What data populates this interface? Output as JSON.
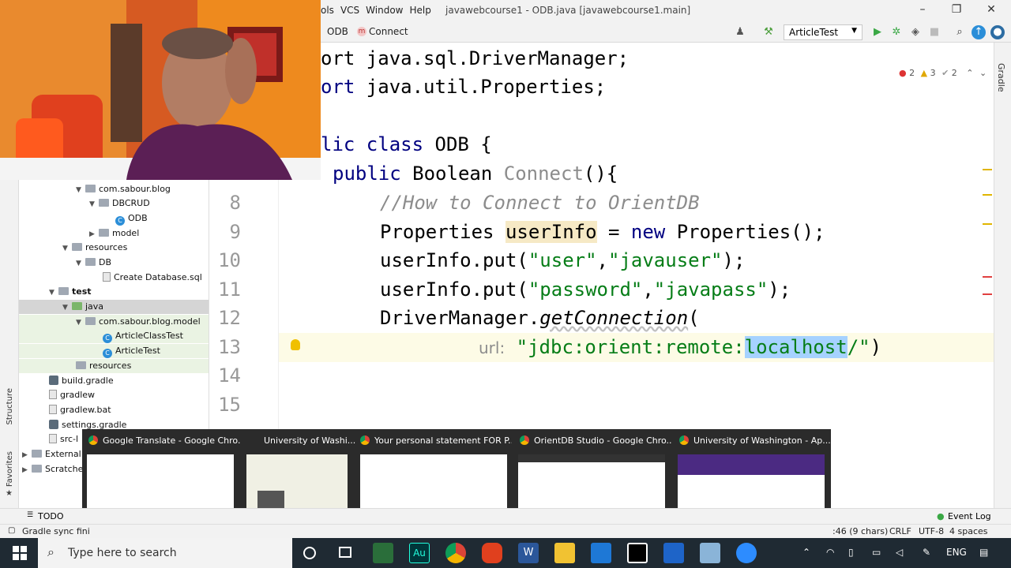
{
  "menu": [
    "ols",
    "VCS",
    "Window",
    "Help"
  ],
  "window_title": "javawebcourse1 - ODB.java [javawebcourse1.main]",
  "breadcrumb": {
    "file": "ODB",
    "method_badge": "m",
    "method": "Connect"
  },
  "run_config": "ArticleTest",
  "inspections": {
    "errors": "2",
    "warnings": "3",
    "weak": "2"
  },
  "side_tabs": {
    "gradle": "Gradle",
    "structure": "Structure",
    "favorites": "Favorites"
  },
  "tree": {
    "pkg_blog": "com.sabour.blog",
    "dbcrud": "DBCRUD",
    "odb": "ODB",
    "model": "model",
    "resources": "resources",
    "db": "DB",
    "create_db": "Create Database.sql",
    "test": "test",
    "java": "java",
    "pkg_model": "com.sabour.blog.model",
    "article_class_test": "ArticleClassTest",
    "article_test": "ArticleTest",
    "resources2": "resources",
    "build_gradle": "build.gradle",
    "gradlew": "gradlew",
    "gradlew_bat": "gradlew.bat",
    "settings_gradle": "settings.gradle",
    "src": "src-l",
    "external": "External",
    "scratches": "Scratche"
  },
  "code": {
    "l_top": "ort java.sql.DriverManager;",
    "l_props_pre": "ort ",
    "l_props": "java.util.Properties;",
    "l_class_pre": "lic ",
    "l_class_kw": "class",
    "l_class_name": " ODB {",
    "l_pub": "public",
    "l_bool": " Boolean ",
    "l_connect": "Connect",
    "l_paren": "(){",
    "n8": "8",
    "c8": "//How to Connect to OrientDB",
    "n9": "9",
    "c9a": "Properties ",
    "c9b": "userInfo",
    "c9c": " = ",
    "c9d": "new",
    "c9e": " Properties();",
    "n10": "10",
    "c10a": "userInfo.put(",
    "c10b": "\"user\"",
    "c10c": ",",
    "c10d": "\"javauser\"",
    "c10e": ");",
    "n11": "11",
    "c11a": "userInfo.put(",
    "c11b": "\"password\"",
    "c11c": ",",
    "c11d": "\"javapass\"",
    "c11e": ");",
    "n12": "12",
    "c12a": "DriverManager.",
    "c12b": "getConnection",
    "c12c": "(",
    "n13": "13",
    "c13hint": "url:",
    "c13a": "\"jdbc:orient:remote:",
    "c13b": "localhost",
    "c13c": "/\"",
    "c13d": ")",
    "n14": "14",
    "n15": "15"
  },
  "previews": [
    {
      "title": "Google Translate - Google Chro..."
    },
    {
      "title": "University of Washi..."
    },
    {
      "title": "Your personal statement FOR P..."
    },
    {
      "title": "OrientDB Studio - Google Chro..."
    },
    {
      "title": "University of Washington - Ap..."
    }
  ],
  "bottom_tabs": {
    "todo": "TODO",
    "event_log": "Event Log"
  },
  "status": {
    "left": "Gradle sync fini",
    "position": ":46 (9 chars)",
    "line_sep": "CRLF",
    "encoding": "UTF-8",
    "indent": "4 spaces"
  },
  "taskbar": {
    "search_placeholder": "Type here to search",
    "lang": "ENG"
  },
  "colors": {
    "keyword": "#000080",
    "string": "#067d17",
    "comment": "#8c8c8c",
    "taskbar": "#1f2a33",
    "selection": "#a6d2ff"
  }
}
